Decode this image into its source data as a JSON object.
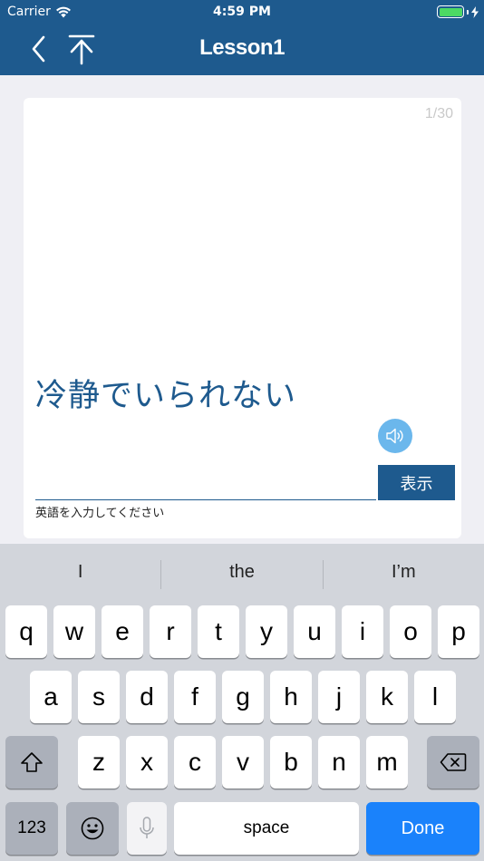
{
  "status": {
    "carrier": "Carrier",
    "time": "4:59 PM"
  },
  "nav": {
    "title": "Lesson1",
    "back_icon": "chevron-left-icon",
    "upload_icon": "upload-icon"
  },
  "card": {
    "counter": "1/30",
    "question": "冷静でいられない",
    "answer_value": "",
    "show_label": "表示",
    "hint": "英語を入力してください"
  },
  "colors": {
    "brand": "#1e5a8e",
    "speaker": "#6bb7ec",
    "done": "#1a82fb",
    "battery": "#4cd964"
  },
  "keyboard": {
    "suggestions": [
      "I",
      "the",
      "I’m"
    ],
    "row1": [
      "q",
      "w",
      "e",
      "r",
      "t",
      "y",
      "u",
      "i",
      "o",
      "p"
    ],
    "row2": [
      "a",
      "s",
      "d",
      "f",
      "g",
      "h",
      "j",
      "k",
      "l"
    ],
    "row3": [
      "z",
      "x",
      "c",
      "v",
      "b",
      "n",
      "m"
    ],
    "numbers_label": "123",
    "space_label": "space",
    "done_label": "Done"
  }
}
